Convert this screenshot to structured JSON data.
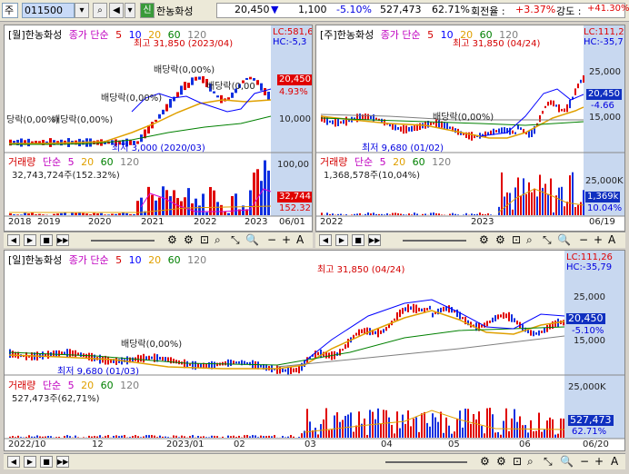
{
  "toolbar": {
    "menu_label": "주",
    "code": "011500",
    "stock_badge": "신",
    "stock_name": "한농화성",
    "price": "20,450",
    "change_arrow": "▼",
    "change": "1,100",
    "change_pct": "-5.10%",
    "volume": "527,473",
    "vol_ratio": "62.71%",
    "turnover_label": "회전율 :",
    "turnover": "+3.37%",
    "strength_label": "강도 :",
    "strength": "+41.30%"
  },
  "monthly": {
    "title": "[월]한농화성",
    "ma_label": "종가 단순",
    "ma": [
      "5",
      "10",
      "20",
      "60",
      "120"
    ],
    "lc": "LC:581,6",
    "hc": "HC:-5,3",
    "high_note": "최고 31,850 (2023/04)",
    "low_note": "최저 3,000 (2020/03)",
    "div1": "당락(0,00%)",
    "div2": "배당락(0,00%)",
    "div3": "배당락(0,00%)",
    "div4": "배당락(0,00%)",
    "div5": "배당락(0,00",
    "price_tag": "20,450",
    "pct_tag": "4.93%",
    "yaxis": [
      "10,000"
    ],
    "vol_title": "거래량",
    "vol_ma_label": "단순",
    "vol_ma": [
      "5",
      "20",
      "60",
      "120"
    ],
    "vol_value": "32,743,724주(152.32%)",
    "vol_axis": "100,00",
    "vol_tag": "32,744",
    "vol_tag2": "152.32",
    "xaxis": [
      "2018",
      "2019",
      "2020",
      "2021",
      "2022",
      "2023",
      "06/01"
    ]
  },
  "weekly": {
    "title": "[주]한농화성",
    "ma_label": "종가 단순",
    "ma": [
      "5",
      "10",
      "20",
      "60",
      "120"
    ],
    "lc": "LC:111,2",
    "hc": "HC:-35,7",
    "high_note": "최고 31,850 (04/24)",
    "low_note": "최저 9,680 (01/02)",
    "div1": "배당락(0,00%)",
    "yaxis": [
      "25,000",
      "15,000"
    ],
    "price_tag": "20,450",
    "pct_tag": "-4.66",
    "vol_title": "거래량",
    "vol_ma_label": "단순",
    "vol_ma": [
      "5",
      "20",
      "60",
      "120"
    ],
    "vol_value": "1,368,578주(10,04%)",
    "vol_axis": "25,000K",
    "vol_tag": "1,369k",
    "vol_tag2": "10.04%",
    "xaxis": [
      "2022",
      "2023",
      "06/19"
    ]
  },
  "daily": {
    "title": "[일]한농화성",
    "ma_label": "종가 단순",
    "ma": [
      "5",
      "10",
      "20",
      "60",
      "120"
    ],
    "lc": "LC:111,26",
    "hc": "HC:-35,79",
    "high_note": "최고 31,850 (04/24)",
    "low_note": "최저 9,680 (01/03)",
    "div1": "배당락(0,00%)",
    "yaxis": [
      "25,000",
      "15,000"
    ],
    "price_tag": "20,450",
    "pct_tag": "-5.10%",
    "vol_title": "거래량",
    "vol_ma_label": "단순",
    "vol_ma": [
      "5",
      "20",
      "60",
      "120"
    ],
    "vol_value": "527,473주(62,71%)",
    "vol_axis": "25,000K",
    "vol_tag": "527,473",
    "vol_tag2": "62.71%",
    "xaxis": [
      "2022/10",
      "12",
      "2023/01",
      "02",
      "03",
      "04",
      "05",
      "06",
      "06/20"
    ]
  },
  "colors": {
    "up": "#e00000",
    "down": "#0000e0",
    "ma5": "#d40000",
    "ma10": "#0000ff",
    "ma20": "#e0a000",
    "ma60": "#008000",
    "ma120": "#7f7f7f",
    "axis_bg": "#c8d8f0"
  },
  "nav": {
    "icons": [
      "step-back-icon",
      "prev-icon",
      "stop-icon",
      "next-icon",
      "slider-icon",
      "settings-icon",
      "zoom-icon",
      "search-icon",
      "minus-icon",
      "plus-icon",
      "text-icon"
    ]
  }
}
